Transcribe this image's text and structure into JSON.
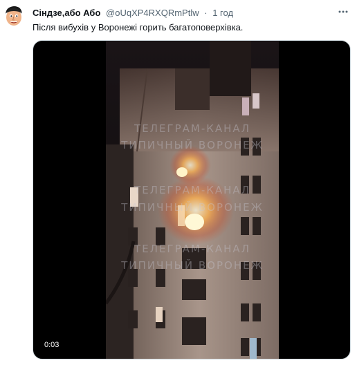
{
  "tweet": {
    "display_name": "Сіндзе,або Або",
    "handle": "@oUqXP4RXQRmPtlw",
    "separator": "·",
    "time": "1 год",
    "more_icon": "more-icon",
    "text": "Після вибухів у Воронежі горить багатоповерхівка."
  },
  "media": {
    "watermark": [
      [
        "ТЕЛЕГРАМ-КАНАЛ",
        "ТИПИЧНЫЙ ВОРОНЕЖ"
      ],
      [
        "ТЕЛЕГРАМ-КАНАЛ",
        "ТИПИЧНЫЙ ВОРОНЕЖ"
      ],
      [
        "ТЕЛЕГРАМ-КАНАЛ",
        "ТИПИЧНЫЙ ВОРОНЕЖ"
      ]
    ],
    "duration": "0:03"
  },
  "colors": {
    "text_primary": "#0f1419",
    "text_secondary": "#536471",
    "media_border": "#cfd9de"
  }
}
